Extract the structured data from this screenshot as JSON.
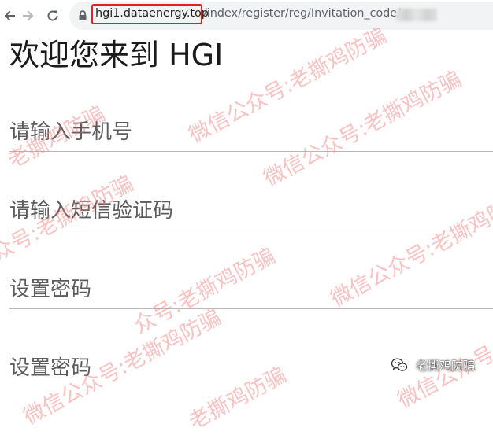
{
  "browser": {
    "url_host": "hgi1.dataenergy.top",
    "url_path": "/index/register/reg/Invitation_code/"
  },
  "page": {
    "title": "欢迎您来到 HGI"
  },
  "form": {
    "phone_placeholder": "请输入手机号",
    "sms_code_placeholder": "请输入短信验证码",
    "password_placeholder": "设置密码",
    "confirm_password_placeholder": "设置密码"
  },
  "overlay": {
    "watermark_texts": [
      "微信公众号:老撕鸡防骗",
      "老撕鸡防骗",
      "微信公众号:老撕鸡防骗",
      "众号:老撕鸡防骗",
      "微信公众号:老撕鸡防骗",
      "众号:老撕鸡防骗",
      "微信公众号:老撕鸡防骗",
      "微信公众号:老撕鸡防骗",
      "老撕鸡防骗"
    ],
    "badge_text": "老撕鸡防骗",
    "watermark_color": "#f07878"
  },
  "icons": {
    "back": "arrow-left-icon",
    "forward": "arrow-right-icon",
    "reload": "reload-icon",
    "lock": "lock-icon",
    "badge": "wechat-icon"
  },
  "colors": {
    "highlight_box": "#e3201b",
    "omnibox_bg": "#f1f3f4",
    "field_underline": "#b8b8b8"
  }
}
